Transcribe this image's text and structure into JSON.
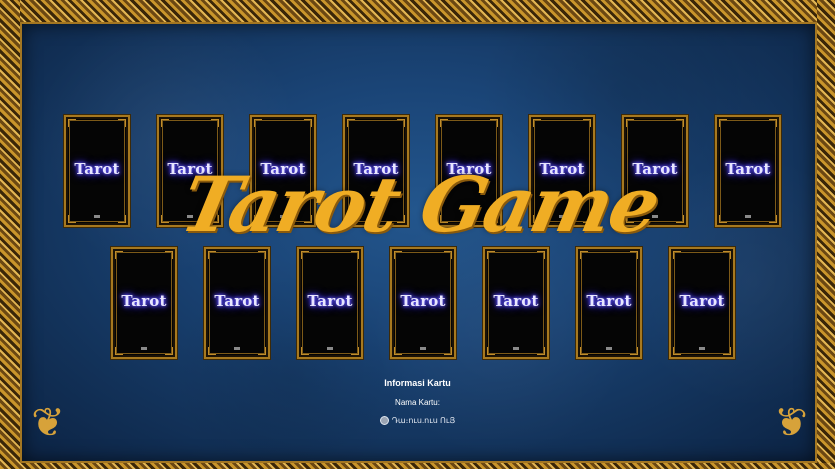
{
  "title": "Tarot Game",
  "cards_row1": [
    {
      "label": "Tarot"
    },
    {
      "label": "Tarot"
    },
    {
      "label": "Tarot"
    },
    {
      "label": "Tarot"
    },
    {
      "label": "Tarot"
    },
    {
      "label": "Tarot"
    },
    {
      "label": "Tarot"
    },
    {
      "label": "Tarot"
    }
  ],
  "cards_row2": [
    {
      "label": "Tarot"
    },
    {
      "label": "Tarot"
    },
    {
      "label": "Tarot"
    },
    {
      "label": "Tarot"
    },
    {
      "label": "Tarot"
    },
    {
      "label": "Tarot"
    },
    {
      "label": "Tarot"
    }
  ],
  "info": {
    "heading": "Informasi Kartu",
    "name_label": "Nama Kartu:",
    "status_icon": "radio-icon",
    "status_text": "Դա։ուս.ուս ՈւՅ"
  },
  "colors": {
    "background": "#1a4476",
    "gold": "#f0ad24",
    "card_glow": "#6e62ff"
  }
}
